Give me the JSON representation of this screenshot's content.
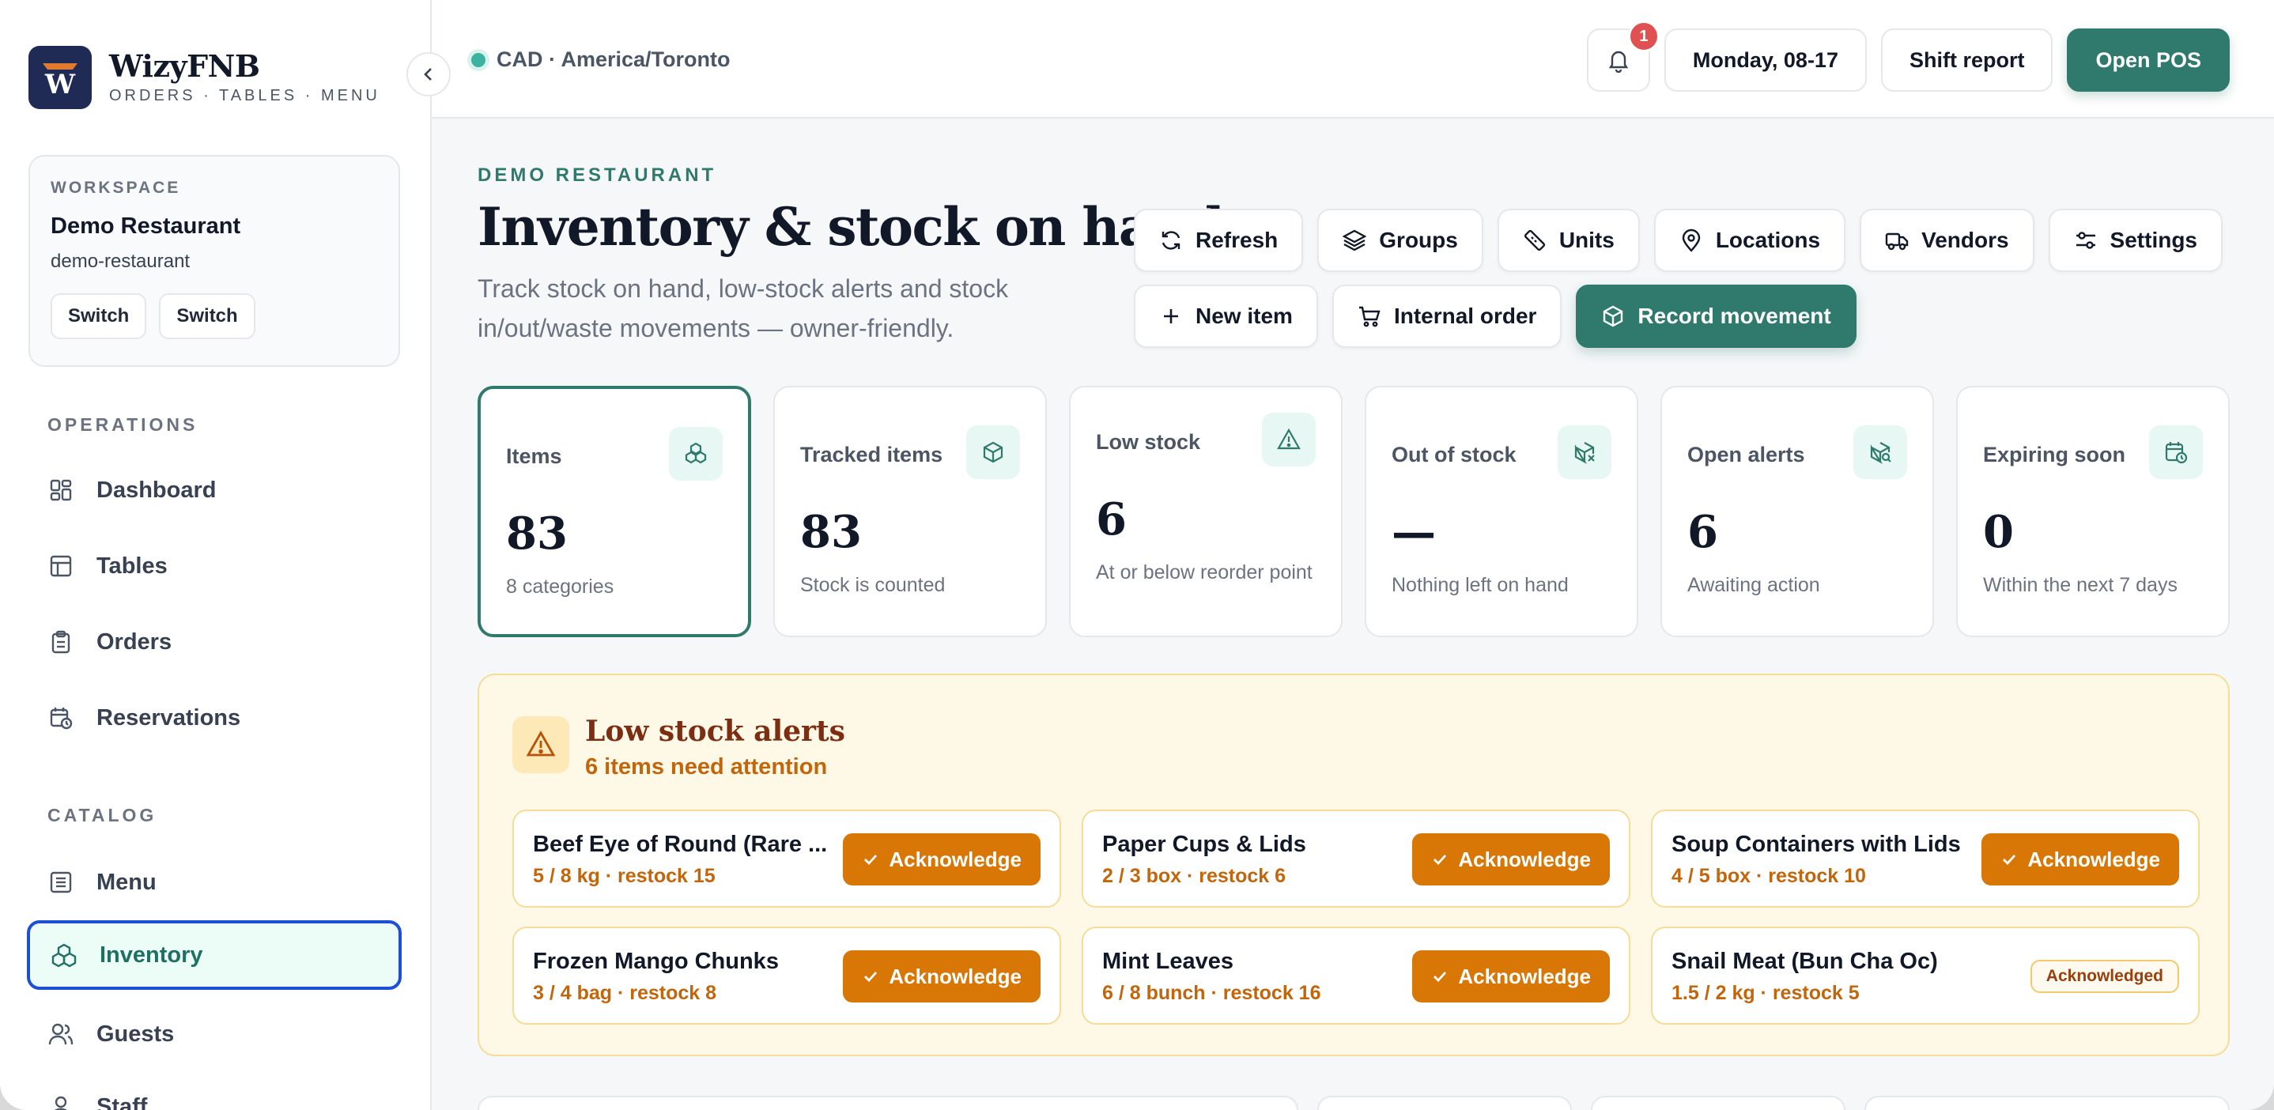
{
  "brand": {
    "name": "WizyFNB",
    "tagline": "ORDERS · TABLES · MENU"
  },
  "workspace": {
    "label": "WORKSPACE",
    "name": "Demo Restaurant",
    "slug": "demo-restaurant",
    "buttons": [
      "Switch",
      "Switch"
    ]
  },
  "nav": {
    "sections": {
      "operations": "OPERATIONS",
      "catalog": "CATALOG"
    },
    "items": [
      {
        "label": "Dashboard",
        "icon": "dashboard-icon"
      },
      {
        "label": "Tables",
        "icon": "table-icon"
      },
      {
        "label": "Orders",
        "icon": "clipboard-icon"
      },
      {
        "label": "Reservations",
        "icon": "calendar-clock-icon"
      },
      {
        "label": "Menu",
        "icon": "menu-list-icon"
      },
      {
        "label": "Inventory",
        "icon": "boxes-icon",
        "active": true
      },
      {
        "label": "Guests",
        "icon": "users-icon"
      },
      {
        "label": "Staff",
        "icon": "staff-icon"
      }
    ]
  },
  "topbar": {
    "locale": "CAD · America/Toronto",
    "notifications": "1",
    "date": "Monday, 08-17",
    "shift_report": "Shift report",
    "open_pos": "Open POS"
  },
  "page": {
    "kicker": "DEMO RESTAURANT",
    "title": "Inventory & stock on hand",
    "subtitle": "Track stock on hand, low-stock alerts and stock in/out/waste movements — owner-friendly."
  },
  "actions": {
    "refresh": "Refresh",
    "groups": "Groups",
    "units": "Units",
    "locations": "Locations",
    "vendors": "Vendors",
    "settings": "Settings",
    "new_item": "New item",
    "internal_order": "Internal order",
    "record_movement": "Record movement"
  },
  "stats": [
    {
      "label": "Items",
      "value": "83",
      "sub": "8 categories"
    },
    {
      "label": "Tracked items",
      "value": "83",
      "sub": "Stock is counted"
    },
    {
      "label": "Low stock",
      "value": "6",
      "sub": "At or below reorder point"
    },
    {
      "label": "Out of stock",
      "value": "—",
      "sub": "Nothing left on hand"
    },
    {
      "label": "Open alerts",
      "value": "6",
      "sub": "Awaiting action"
    },
    {
      "label": "Expiring soon",
      "value": "0",
      "sub": "Within the next 7 days"
    }
  ],
  "alerts": {
    "title": "Low stock alerts",
    "subtitle": "6 items need attention",
    "ack_label": "Acknowledge",
    "acked_label": "Acknowledged",
    "items": [
      {
        "name": "Beef Eye of Round (Rare ...",
        "meta": "5 / 8 kg · restock 15"
      },
      {
        "name": "Paper Cups & Lids",
        "meta": "2 / 3 box · restock 6"
      },
      {
        "name": "Soup Containers with Lids",
        "meta": "4 / 5 box · restock 10"
      },
      {
        "name": "Frozen Mango Chunks",
        "meta": "3 / 4 bag · restock 8"
      },
      {
        "name": "Mint Leaves",
        "meta": "6 / 8 bunch · restock 16"
      },
      {
        "name": "Snail Meat (Bun Cha Oc)",
        "meta": "1.5 / 2 kg · restock 5"
      }
    ]
  },
  "colors": {
    "accent": "#2f7a6c",
    "warning": "#d97706",
    "alert_bg": "#fef8e7",
    "active_border": "#1d4ed8"
  }
}
